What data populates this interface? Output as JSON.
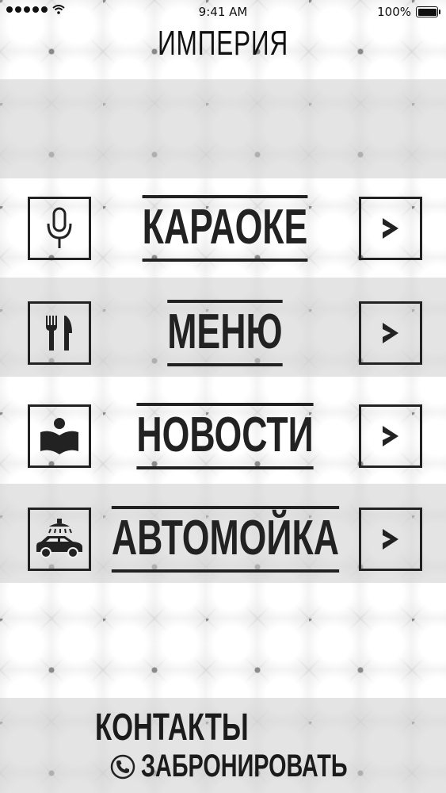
{
  "status_bar": {
    "time": "9:41 AM",
    "battery": "100%"
  },
  "app": {
    "title": "ИМПЕРИЯ"
  },
  "menu": [
    {
      "label": "КАРАОКЕ",
      "icon": "microphone-icon"
    },
    {
      "label": "МЕНЮ",
      "icon": "fork-knife-icon"
    },
    {
      "label": "НОВОСТИ",
      "icon": "reading-icon"
    },
    {
      "label": "АВТОМОЙКА",
      "icon": "car-wash-icon"
    }
  ],
  "footer": {
    "contacts": "КОНТАКТЫ",
    "book": "ЗАБРОНИРОВАТЬ"
  },
  "colors": {
    "ink": "#222222",
    "background": "#e6e6e6"
  }
}
